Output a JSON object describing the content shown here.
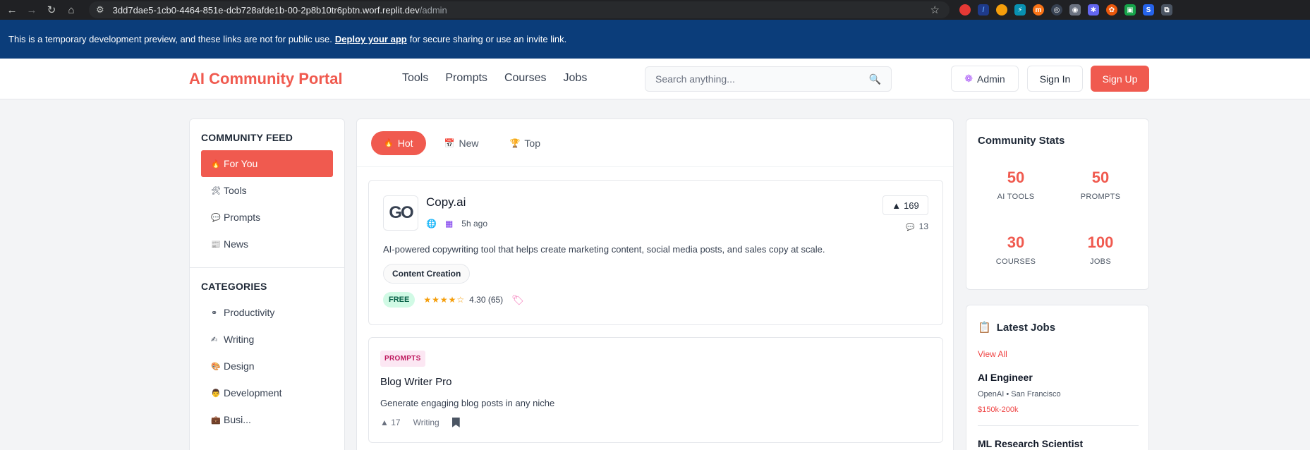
{
  "browser": {
    "url_host": "3dd7dae5-1cb0-4464-851e-dcb728afde1b-00-2p8b10tr6pbtn.worf.replit.dev",
    "url_path": "/admin"
  },
  "banner": {
    "text_before": "This is a temporary development preview, and these links are not for public use.",
    "link": "Deploy your app",
    "text_after": "for secure sharing or use an invite link."
  },
  "header": {
    "logo": "AI Community Portal",
    "nav": [
      "Tools",
      "Prompts",
      "Courses",
      "Jobs"
    ],
    "search_placeholder": "Search anything...",
    "admin": "Admin",
    "signin": "Sign In",
    "signup": "Sign Up"
  },
  "sidebar": {
    "feed_heading": "COMMUNITY FEED",
    "feed_items": [
      {
        "label": "For You",
        "icon": "fire-icon"
      },
      {
        "label": "Tools",
        "icon": "tools-icon"
      },
      {
        "label": "Prompts",
        "icon": "speech-bubble-icon"
      },
      {
        "label": "News",
        "icon": "newspaper-icon"
      }
    ],
    "categories_heading": "CATEGORIES",
    "categories": [
      {
        "label": "Productivity",
        "icon": "bone-icon"
      },
      {
        "label": "Writing",
        "icon": "writing-hand-icon"
      },
      {
        "label": "Design",
        "icon": "palette-icon"
      },
      {
        "label": "Development",
        "icon": "developer-icon"
      },
      {
        "label": "Busi...",
        "icon": "briefcase-icon"
      }
    ]
  },
  "feed": {
    "tabs": [
      {
        "label": "Hot",
        "icon": "fire-icon"
      },
      {
        "label": "New",
        "icon": "calendar-icon"
      },
      {
        "label": "Top",
        "icon": "trophy-icon"
      }
    ],
    "tool_card": {
      "logo": "GO",
      "name": "Copy.ai",
      "time": "5h ago",
      "votes": "169",
      "comments": "13",
      "description": "AI-powered copywriting tool that helps create marketing content, social media posts, and sales copy at scale.",
      "tag": "Content Creation",
      "pricing": "FREE",
      "stars": "★★★★☆",
      "rating": "4.30 (65)"
    },
    "prompt_card": {
      "badge": "PROMPTS",
      "title": "Blog Writer Pro",
      "description": "Generate engaging blog posts in any niche",
      "votes": "17",
      "category": "Writing"
    }
  },
  "stats": {
    "title": "Community Stats",
    "items": [
      {
        "value": "50",
        "label": "AI TOOLS"
      },
      {
        "value": "50",
        "label": "PROMPTS"
      },
      {
        "value": "30",
        "label": "COURSES"
      },
      {
        "value": "100",
        "label": "JOBS"
      }
    ]
  },
  "jobs": {
    "title": "Latest Jobs",
    "view_all": "View All",
    "items": [
      {
        "title": "AI Engineer",
        "company": "OpenAI • San Francisco",
        "salary": "$150k-200k"
      },
      {
        "title": "ML Research Scientist"
      }
    ]
  },
  "colors": {
    "accent": "#f05a4f",
    "banner": "#0b3d7a"
  }
}
